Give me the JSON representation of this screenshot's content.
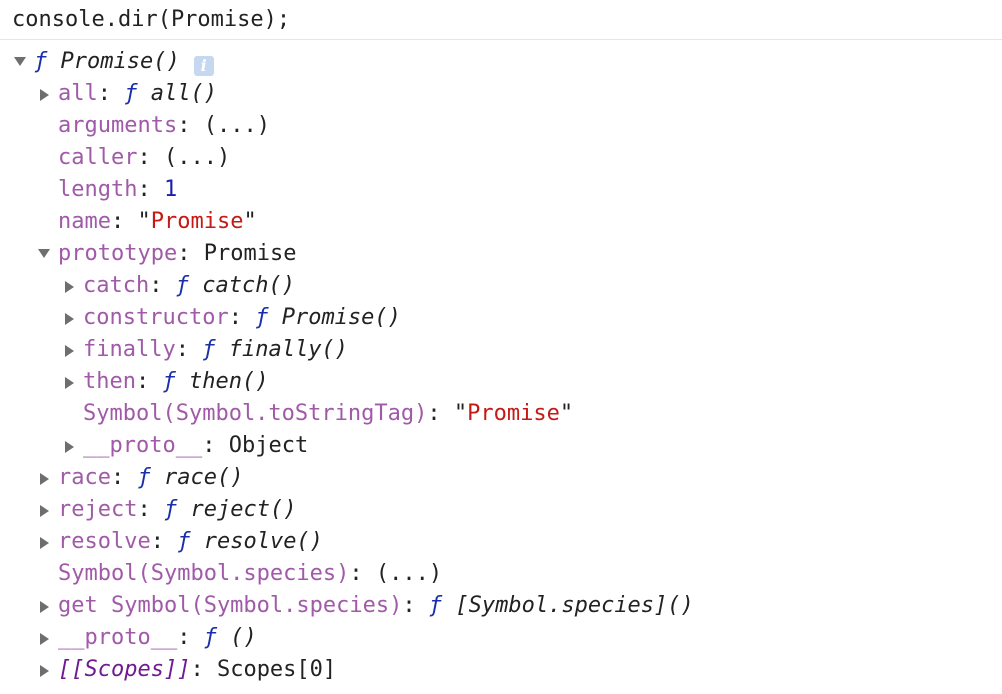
{
  "input": {
    "text": "console.dir(Promise);"
  },
  "tree": {
    "root": {
      "f": "ƒ",
      "name": "Promise()",
      "info": "i"
    },
    "rows": [
      {
        "key": "all",
        "f": "ƒ",
        "fn": "all()"
      },
      {
        "key": "arguments",
        "value": "(...)"
      },
      {
        "key": "caller",
        "value": "(...)"
      },
      {
        "key": "length",
        "value": "1"
      },
      {
        "key": "name",
        "value": "Promise"
      },
      {
        "key": "prototype",
        "value": "Promise"
      },
      {
        "key": "catch",
        "f": "ƒ",
        "fn": "catch()"
      },
      {
        "key": "constructor",
        "f": "ƒ",
        "fn": "Promise()"
      },
      {
        "key": "finally",
        "f": "ƒ",
        "fn": "finally()"
      },
      {
        "key": "then",
        "f": "ƒ",
        "fn": "then()"
      },
      {
        "key": "Symbol(Symbol.toStringTag)",
        "value": "Promise"
      },
      {
        "key": "__proto__",
        "value": "Object"
      },
      {
        "key": "race",
        "f": "ƒ",
        "fn": "race()"
      },
      {
        "key": "reject",
        "f": "ƒ",
        "fn": "reject()"
      },
      {
        "key": "resolve",
        "f": "ƒ",
        "fn": "resolve()"
      },
      {
        "key": "Symbol(Symbol.species)",
        "value": "(...)"
      },
      {
        "key": "get Symbol(Symbol.species)",
        "f": "ƒ",
        "fn": "[Symbol.species]()"
      },
      {
        "key": "__proto__",
        "f": "ƒ",
        "fn": "()"
      },
      {
        "key": "[[Scopes]]",
        "value": "Scopes[0]"
      }
    ]
  },
  "colors": {
    "key": "#a05aa8",
    "internal_key": "#6f1a91",
    "function_marker": "#1a2fa8",
    "number": "#1c1cae",
    "string": "#c41a16",
    "info_icon_bg": "#c5d8ef"
  }
}
